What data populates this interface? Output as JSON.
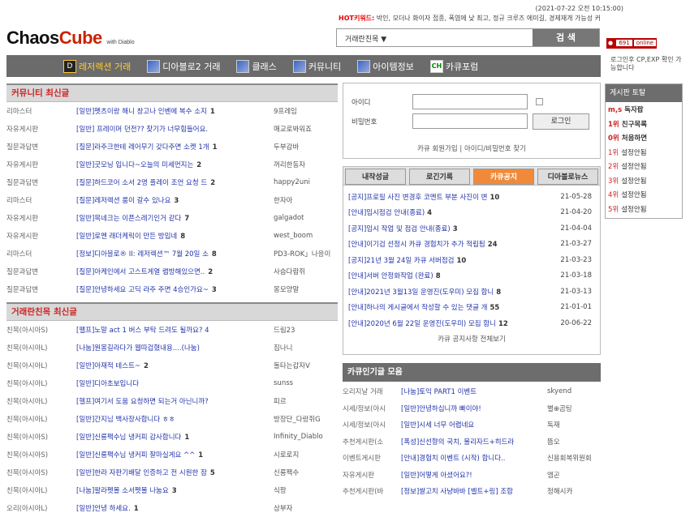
{
  "header": {
    "datetime": "(2021-07-22 오전 10:15:00)",
    "hot_label": "HOT키워드:",
    "hot_keywords": "박인, 모더나 화이자 접종, 폭염에 낮 최고, 정규 크루즈 에미길, 경제재개 가능성 커",
    "logo_chaos": "Chaos",
    "logo_cube": "Cube",
    "logo_sub": "with Diablo",
    "search_select": "거래란친목 ▼",
    "search_button": "검 색",
    "ad_text": "691",
    "ad_sub": "online",
    "side_note": "로그인후 CP,EXP 확인 가능합니다"
  },
  "nav": [
    {
      "label": "레저렉션 거래",
      "icon": "diablo-icon"
    },
    {
      "label": "디아블로2 거래",
      "icon": "game-icon"
    },
    {
      "label": "클래스",
      "icon": "class-icon"
    },
    {
      "label": "커뮤니티",
      "icon": "community-icon"
    },
    {
      "label": "아이템정보",
      "icon": "item-icon"
    },
    {
      "label": "카큐포럼",
      "icon": "ch-icon"
    }
  ],
  "community": {
    "title": "커뮤니티 최신글",
    "rows": [
      {
        "cat": "리마스터",
        "title": "[일반]펫츠이랑 해니 창고나 인벤에 복수 소지",
        "count": "1",
        "author": "9프레임"
      },
      {
        "cat": "자유게시판",
        "title": "[일반] 프레이머 던전?? 찾기가 너무힘들어요.",
        "count": "",
        "author": "매교로봐워죠"
      },
      {
        "cat": "질문과답변",
        "title": "[질문]라주크한테 레어무기 갖다주면 소켓 1개",
        "count": "1",
        "author": "두부감바"
      },
      {
        "cat": "자유게시판",
        "title": "[일반]굿모닝 입니다~오늘의 미세먼지는",
        "count": "2",
        "author": "꺼리한동자"
      },
      {
        "cat": "질문과답변",
        "title": "[질문]하드코어 소서 2명 플레이 조언 요청 드",
        "count": "2",
        "author": "happy2uni"
      },
      {
        "cat": "리마스터",
        "title": "[질문]레저렉션 룸이 갈수 있나요",
        "count": "3",
        "author": "한자아"
      },
      {
        "cat": "자유게시판",
        "title": "[일반]목네크는 이픈스레기인거 같다",
        "count": "7",
        "author": "galgadot"
      },
      {
        "cat": "자유게시판",
        "title": "[일반]로멘 래더케릭이 만든 방입네",
        "count": "8",
        "author": "west_boom"
      },
      {
        "cat": "리마스터",
        "title": "[정보]디아블로® II: 레저렉션™ 7월 20일 소",
        "count": "8",
        "author": "PD3-ROK」나응이"
      },
      {
        "cat": "질문과답변",
        "title": "[질문]아케인에서 고스트게열 랩방해있으면..",
        "count": "2",
        "author": "사슴다람쥐"
      },
      {
        "cat": "질문과답변",
        "title": "[질문]안녕하세요 고딕 라주 주면 4승인가요~",
        "count": "3",
        "author": "몽모양말"
      }
    ]
  },
  "trade": {
    "title": "거래란친목 최신글",
    "rows": [
      {
        "cat": "친목(아시아S)",
        "title": "[팰프]노말 act 1 버스 부탁 드려도 될까요? 4",
        "count": "",
        "author": "드림23"
      },
      {
        "cat": "친목(아시아L)",
        "title": "[나눔]원몽길라다가 웹따겁혔내용....(나눔)",
        "count": "",
        "author": "짐나니"
      },
      {
        "cat": "친목(아시아L)",
        "title": "[일반]아재적 테스트~",
        "count": "2",
        "author": "돌타는갑자V"
      },
      {
        "cat": "친목(아시아L)",
        "title": "[일반]디아초보입니다",
        "count": "",
        "author": "sunss"
      },
      {
        "cat": "친목(아시아L)",
        "title": "[헬프]여기서 도움 요청하면 되는거 아닌니까?",
        "count": "",
        "author": "피르"
      },
      {
        "cat": "친목(아시아L)",
        "title": "[일반]간지님 백사장사합니다 ㅎㅎ",
        "count": "",
        "author": "방장단_다랑쥐G"
      },
      {
        "cat": "친목(아시아S)",
        "title": "[일반]신룡팩수님 냉커피 감사합니다",
        "count": "1",
        "author": "Infinity_Diablo"
      },
      {
        "cat": "친목(아시아S)",
        "title": "[일반]신룡팩수님 냉커피 잘마실게요 ^^",
        "count": "1",
        "author": "시로로지"
      },
      {
        "cat": "친목(아시아S)",
        "title": "[일반]한라 자판기배달 인증하고 전 시원한 잠",
        "count": "5",
        "author": "신룡팩수"
      },
      {
        "cat": "친목(아시아L)",
        "title": "[나눔]팔라펫몰 소서펫몰 나눔요",
        "count": "3",
        "author": "식팡"
      },
      {
        "cat": "오리(아시아L)",
        "title": "[일반]안녕 하세요.",
        "count": "1",
        "author": "삼부자"
      }
    ]
  },
  "login": {
    "id_label": "아이디",
    "pw_label": "비밀번호",
    "login_button": "로그인",
    "links": "카큐 회원가입 | 아이디/비밀번호 찾기"
  },
  "notice": {
    "tabs": [
      "내작성글",
      "로긴기록",
      "카큐공지",
      "디아블로뉴스"
    ],
    "active_tab": 2,
    "rows": [
      {
        "title": "[공지]프로필 사진 변경후 코멘트 부분 사진이 변",
        "count": "10",
        "date": "21-05-28"
      },
      {
        "title": "[안내]임시점검 안내(종료)",
        "count": "4",
        "date": "21-04-20"
      },
      {
        "title": "[공지]임시 작업 및 점검 안내(종료)",
        "count": "3",
        "date": "21-04-04"
      },
      {
        "title": "[안내]이기검 선정시 카큐 경험치가 추가 적립됩",
        "count": "24",
        "date": "21-03-27"
      },
      {
        "title": "[공지]21년 3월 24일 카큐 서버점검",
        "count": "10",
        "date": "21-03-23"
      },
      {
        "title": "[안내]서버 안정화작업 (완료)",
        "count": "8",
        "date": "21-03-18"
      },
      {
        "title": "[안내]2021년 3월13일 운영진(도우미) 모집 합니",
        "count": "8",
        "date": "21-03-13"
      },
      {
        "title": "[안내]하나의 게시글에서 작성할 수 있는 댓글 개",
        "count": "55",
        "date": "21-01-01"
      },
      {
        "title": "[안내]2020년 6월 22일 운영진(도우미) 모집 합니",
        "count": "12",
        "date": "20-06-22"
      }
    ],
    "more": "카큐 공지사항 전체보기"
  },
  "popular": {
    "title": "카큐인기글 모음",
    "rows": [
      {
        "cat": "오리지날 거래",
        "title": "[나눔]토익 PART1 이벤트",
        "author": "skyend"
      },
      {
        "cat": "시세/정보(아시",
        "title": "[일반]안녕하십니까 빠이야!",
        "author": "별⊕곰팅"
      },
      {
        "cat": "시세/정보(아시",
        "title": "[일반]시세 너무 어렵네요",
        "author": "독재"
      },
      {
        "cat": "추천게시판(소",
        "title": "[폭성]신선향의 국치, 물리자드+히드라",
        "author": "뜸오"
      },
      {
        "cat": "이벤트게시판",
        "title": "[안내]경험치 이벤트 (시작) 합니다..",
        "author": "신용회복위원회"
      },
      {
        "cat": "자유게시판",
        "title": "[일반]어떻게 아셨어요?!",
        "author": "엠곤"
      },
      {
        "cat": "추천게시판(바",
        "title": "[정보]쌀고치 사냥바바 [벨트+링] 조합",
        "author": "정해시카"
      }
    ]
  },
  "board": {
    "title": "게시판 토탈",
    "items": [
      {
        "prefix": "m,s",
        "label": "독자팝",
        "bold": true
      },
      {
        "prefix": "1위",
        "label": "친구목록",
        "bold": true
      },
      {
        "prefix": "0위",
        "label": "처음하면",
        "bold": true
      },
      {
        "prefix": "1위",
        "label": "설정안됨",
        "bold": false
      },
      {
        "prefix": "2위",
        "label": "설정안됨",
        "bold": false
      },
      {
        "prefix": "3위",
        "label": "설정안됨",
        "bold": false
      },
      {
        "prefix": "4위",
        "label": "설정안됨",
        "bold": false
      },
      {
        "prefix": "5위",
        "label": "설정안됨",
        "bold": false
      }
    ]
  }
}
